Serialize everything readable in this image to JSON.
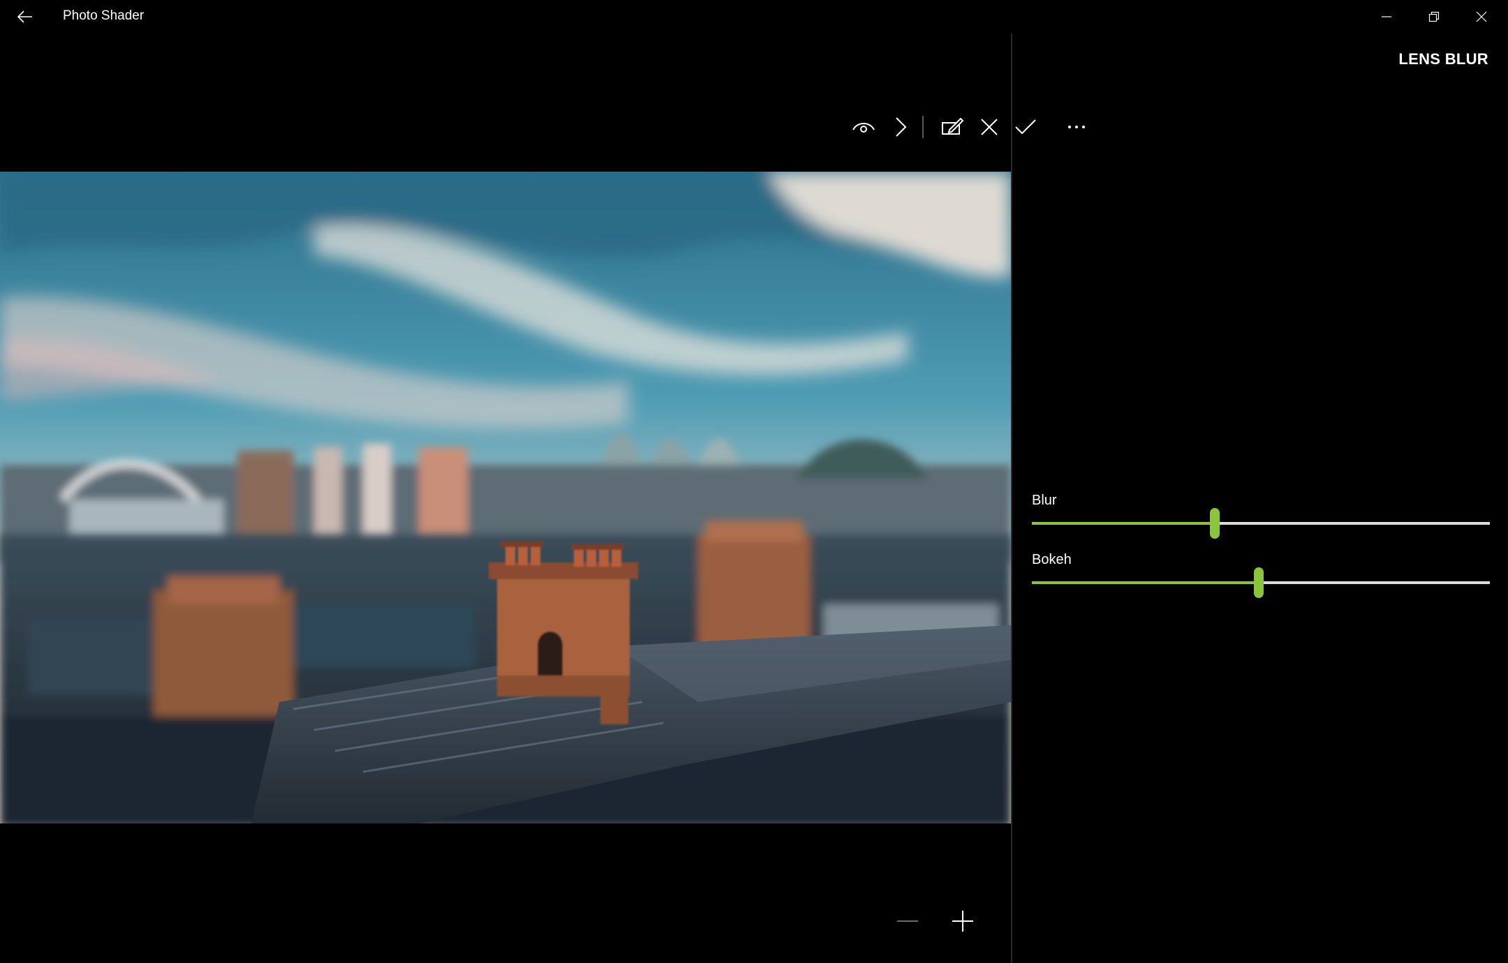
{
  "app": {
    "title": "Photo Shader"
  },
  "titlebar": {
    "back_icon": "back-arrow-icon",
    "minimize_icon": "minimize-icon",
    "maximize_icon": "restore-icon",
    "close_icon": "close-icon"
  },
  "panel": {
    "title": "LENS BLUR",
    "toolbar": [
      {
        "name": "preview",
        "icon": "eye-icon"
      },
      {
        "name": "next",
        "icon": "chevron-right-icon"
      },
      {
        "name": "edit-mask",
        "icon": "edit-icon"
      },
      {
        "name": "cancel",
        "icon": "close-icon"
      },
      {
        "name": "apply",
        "icon": "checkmark-icon"
      },
      {
        "name": "more",
        "icon": "more-icon"
      }
    ],
    "sliders": [
      {
        "label": "Blur",
        "value": 0.4
      },
      {
        "label": "Bokeh",
        "value": 0.495
      }
    ]
  },
  "zoom": {
    "zoom_out_icon": "minus-icon",
    "zoom_in_icon": "plus-icon"
  },
  "colors": {
    "accent": "#8cc43c",
    "background": "#000000",
    "track": "#dcdcdc"
  }
}
